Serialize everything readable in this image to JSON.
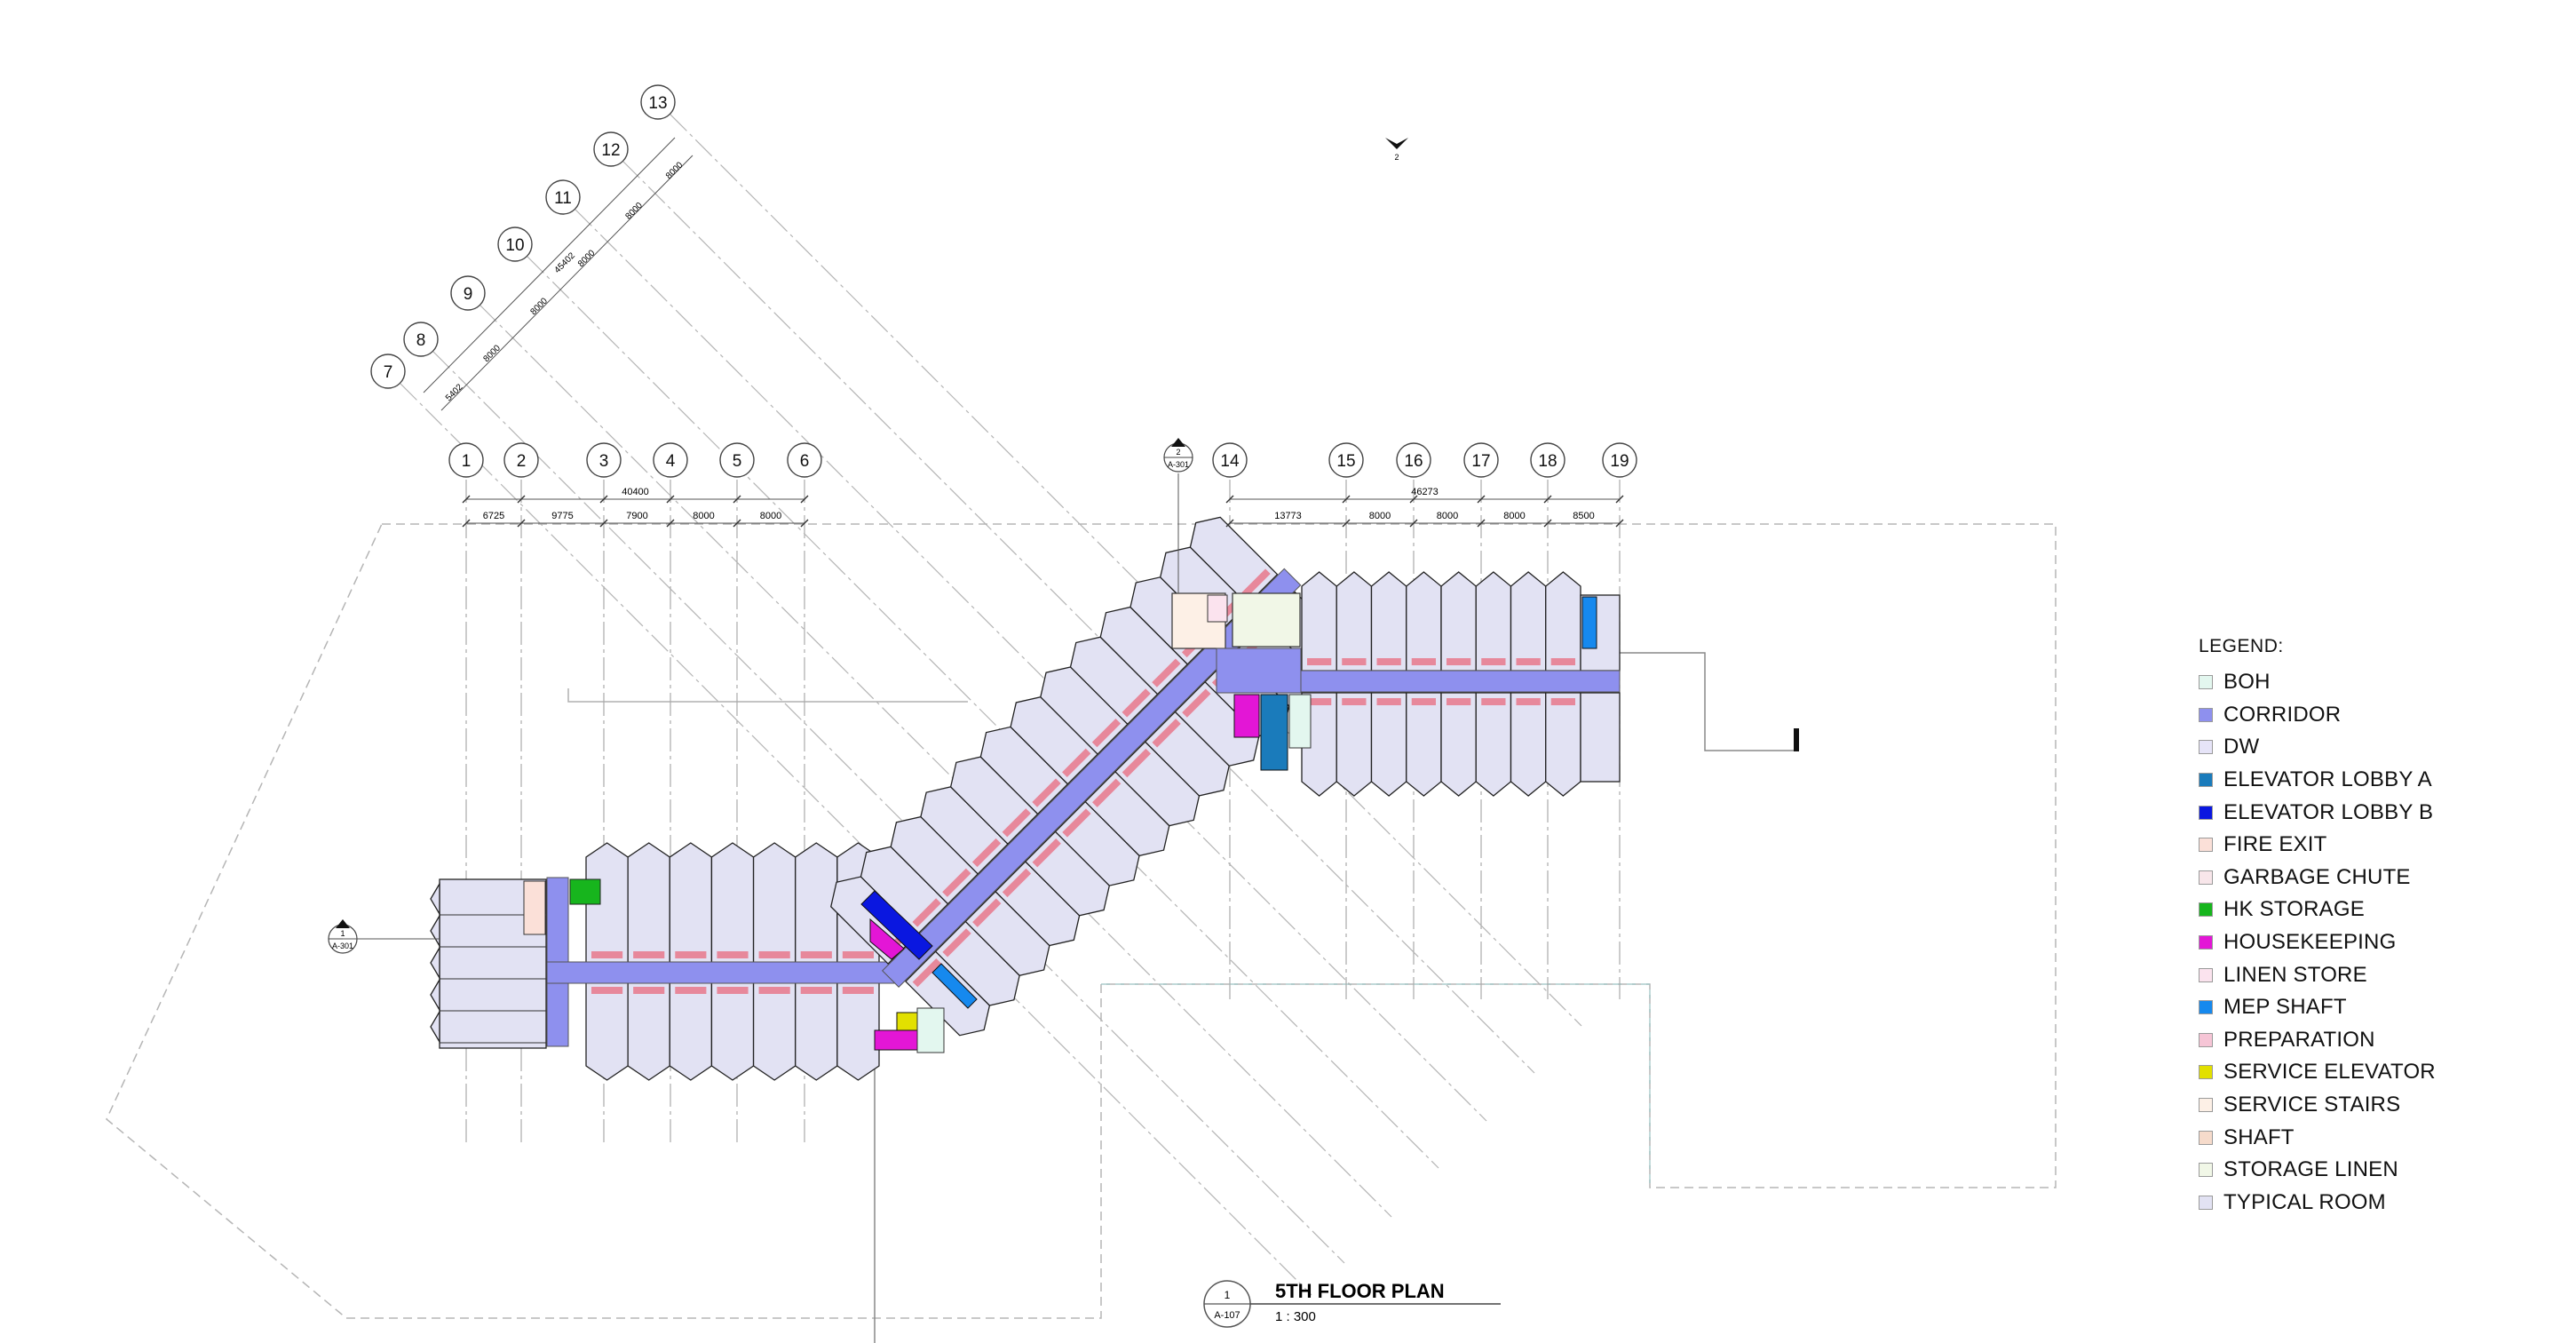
{
  "drawing": {
    "title": "5TH FLOOR PLAN",
    "scale": "1 : 300",
    "view_number": "1",
    "sheet_ref": "A-107",
    "section_marks": [
      {
        "number": "1",
        "sheet": "A-301"
      },
      {
        "number": "2",
        "sheet": "A-301"
      },
      {
        "number": "2",
        "sheet": ""
      }
    ],
    "bottom_gridlines": [
      "1",
      "2",
      "3",
      "4",
      "5",
      "6"
    ],
    "bottom_total": "40400",
    "bottom_spacings": [
      "6725",
      "9775",
      "7900",
      "8000",
      "8000"
    ],
    "right_gridlines": [
      "14",
      "15",
      "16",
      "17",
      "18",
      "19"
    ],
    "right_total": "46273",
    "right_spacings": [
      "13773",
      "8000",
      "8000",
      "8000",
      "8500"
    ],
    "diagonal_gridlines": [
      "7",
      "8",
      "9",
      "10",
      "11",
      "12",
      "13"
    ],
    "diagonal_total": "45402",
    "diagonal_spacings": [
      "5402",
      "8000",
      "8000",
      "8000",
      "8000",
      "8000"
    ]
  },
  "legend": {
    "title": "LEGEND:",
    "items": [
      {
        "label": "BOH",
        "color": "#e3f7ef"
      },
      {
        "label": "CORRIDOR",
        "color": "#8e90ee"
      },
      {
        "label": "DW",
        "color": "#e6e4f8"
      },
      {
        "label": "ELEVATOR LOBBY A",
        "color": "#1a7bbb"
      },
      {
        "label": "ELEVATOR LOBBY B",
        "color": "#0a17e0"
      },
      {
        "label": "FIRE EXIT",
        "color": "#fbe0d8"
      },
      {
        "label": "GARBAGE CHUTE",
        "color": "#f8e6ea"
      },
      {
        "label": "HK STORAGE",
        "color": "#17b51d"
      },
      {
        "label": "HOUSEKEEPING",
        "color": "#e316d6"
      },
      {
        "label": "LINEN STORE",
        "color": "#fbe3ee"
      },
      {
        "label": "MEP SHAFT",
        "color": "#1689ee"
      },
      {
        "label": "PREPARATION",
        "color": "#f6c5d6"
      },
      {
        "label": "SERVICE ELEVATOR",
        "color": "#e2e000"
      },
      {
        "label": "SERVICE STAIRS",
        "color": "#fdf0e6"
      },
      {
        "label": "SHAFT",
        "color": "#f6dbcb"
      },
      {
        "label": "STORAGE LINEN",
        "color": "#f1f7e7"
      },
      {
        "label": "TYPICAL ROOM",
        "color": "#e2e2f3"
      }
    ]
  }
}
